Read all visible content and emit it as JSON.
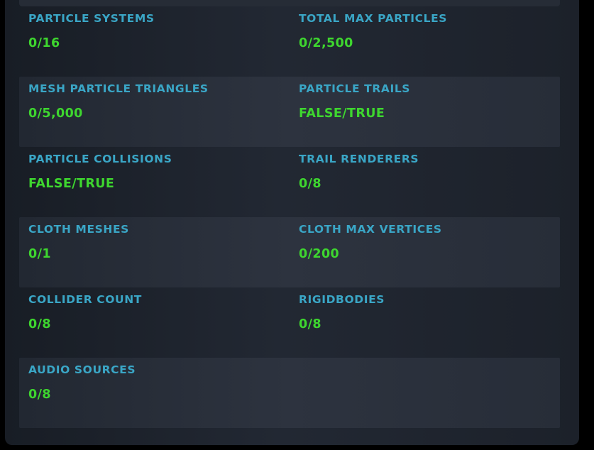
{
  "colors": {
    "label": "#3aa6c6",
    "value": "#3ed62f",
    "panel": "#1c212a",
    "row_alt": "#2a303b"
  },
  "stats": [
    {
      "left": {
        "label": "PARTICLE SYSTEMS",
        "value": "0/16"
      },
      "right": {
        "label": "TOTAL MAX PARTICLES",
        "value": "0/2,500"
      }
    },
    {
      "left": {
        "label": "MESH PARTICLE TRIANGLES",
        "value": "0/5,000"
      },
      "right": {
        "label": "PARTICLE TRAILS",
        "value": "FALSE/TRUE"
      }
    },
    {
      "left": {
        "label": "PARTICLE COLLISIONS",
        "value": "FALSE/TRUE"
      },
      "right": {
        "label": "TRAIL RENDERERS",
        "value": "0/8"
      }
    },
    {
      "left": {
        "label": "CLOTH MESHES",
        "value": "0/1"
      },
      "right": {
        "label": "CLOTH MAX VERTICES",
        "value": "0/200"
      }
    },
    {
      "left": {
        "label": "COLLIDER COUNT",
        "value": "0/8"
      },
      "right": {
        "label": "RIGIDBODIES",
        "value": "0/8"
      }
    },
    {
      "left": {
        "label": "AUDIO SOURCES",
        "value": "0/8"
      }
    }
  ]
}
